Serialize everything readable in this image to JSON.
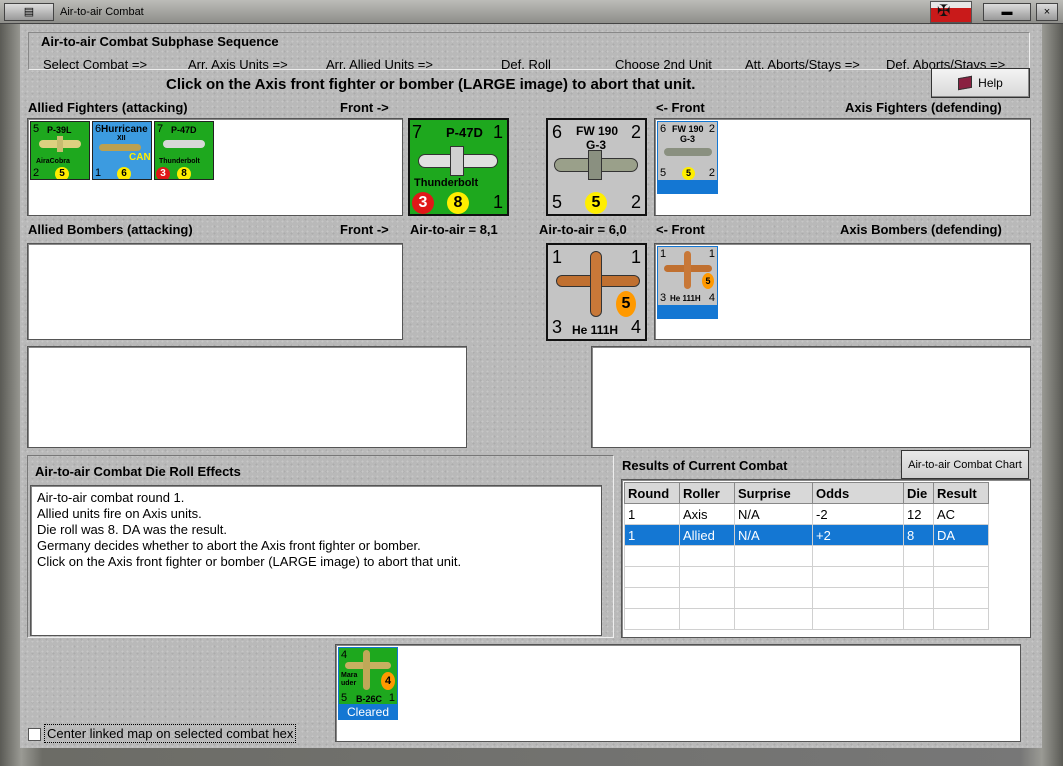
{
  "window": {
    "title": "Air-to-air Combat"
  },
  "sequence": {
    "title": "Air-to-air Combat Subphase Sequence",
    "steps": [
      "Select Combat =>",
      "Arr. Axis Units =>",
      "Arr. Allied Units =>",
      "Def. Roll",
      "Choose 2nd Unit",
      "Att. Aborts/Stays =>",
      "Def. Aborts/Stays =>"
    ]
  },
  "instruction": "Click on the Axis front fighter or bomber  (LARGE image) to abort that unit.",
  "help_label": "Help",
  "headers": {
    "allied_fighters": "Allied Fighters (attacking)",
    "front_right": "Front ->",
    "front_left": "<- Front",
    "axis_fighters": "Axis Fighters (defending)",
    "allied_bombers": "Allied Bombers (attacking)",
    "axis_bombers": "Axis Bombers (defending)",
    "allied_a2a": "Air-to-air = 8,1",
    "axis_a2a": "Air-to-air = 6,0"
  },
  "allied_fighters": [
    {
      "name": "P-39L",
      "sub": "AiraCobra",
      "tl": "5",
      "tr": "",
      "bl": "2",
      "br": "",
      "die": "5",
      "color": "green"
    },
    {
      "name": "Hurricane",
      "sub": "XII",
      "tl": "6",
      "tr": "",
      "bl": "1",
      "br": "",
      "die": "6",
      "nation": "CAN",
      "color": "blue"
    },
    {
      "name": "P-47D",
      "sub": "Thunderbolt",
      "tl": "7",
      "tr": "",
      "bl": "3",
      "br": "",
      "die": "8",
      "color": "green"
    }
  ],
  "front_allied": {
    "name": "P-47D",
    "sub": "Thunderbolt",
    "tl": "7",
    "tr": "1",
    "bl": "3",
    "die": "8",
    "br": "1"
  },
  "front_axis_fighter": {
    "name": "FW 190",
    "sub": "G-3",
    "tl": "6",
    "tr": "2",
    "bl": "5",
    "die": "5",
    "br": "2"
  },
  "axis_fighter_small": {
    "name": "FW 190",
    "sub": "G-3",
    "tl": "6",
    "tr": "2",
    "bl": "5",
    "die": "5",
    "br": "2"
  },
  "front_axis_bomber": {
    "name": "He 111H",
    "tl": "1",
    "tr": "1",
    "bl": "3",
    "die": "5",
    "br": "4"
  },
  "axis_bomber_small": {
    "name": "He 111H",
    "tl": "1",
    "tr": "1",
    "bl": "3",
    "die": "5",
    "br": "4"
  },
  "effects": {
    "title": "Air-to-air Combat Die Roll Effects",
    "lines": [
      "Air-to-air combat round 1.",
      "Allied units fire on Axis units.",
      "Die roll was 8.  DA was the result.",
      "Germany decides whether to abort the Axis front fighter or bomber.",
      "Click on the Axis front fighter or bomber  (LARGE image) to abort that unit."
    ]
  },
  "results": {
    "title": "Results of Current Combat",
    "chart_button": "Air-to-air Combat Chart",
    "columns": [
      "Round",
      "Roller",
      "Surprise",
      "Odds",
      "Die",
      "Result"
    ],
    "rows": [
      [
        "1",
        "Axis",
        "N/A",
        "-2",
        "12",
        "AC"
      ],
      [
        "1",
        "Allied",
        "N/A",
        "+2",
        "8",
        "DA"
      ]
    ],
    "selected_row": 1
  },
  "cleared": {
    "name": "Marauder",
    "sub": "B-26C",
    "tl": "4",
    "bl": "5",
    "br": "1",
    "die": "4",
    "label": "Cleared"
  },
  "center_map_label": "Center linked map on selected combat hex",
  "colors": {
    "selection": "#1477d3",
    "counter_green": "#1ea81e",
    "counter_gray": "#c4c4c4",
    "counter_blue": "#3c9be0",
    "die_yellow": "#ffee00",
    "die_red": "#e01818",
    "die_orange": "#ff9900"
  }
}
